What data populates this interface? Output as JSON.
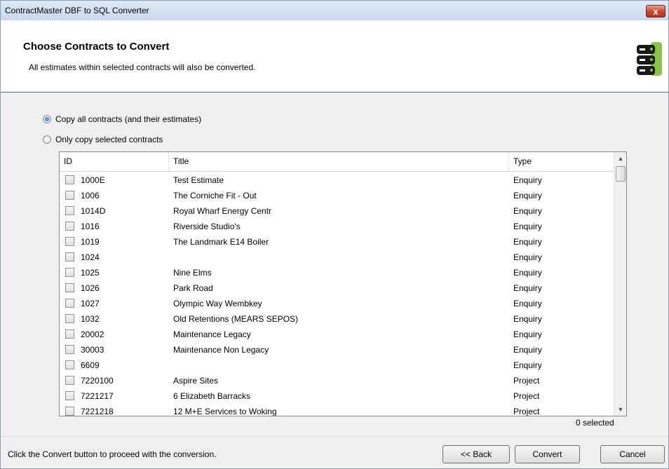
{
  "window": {
    "title": "ContractMaster DBF to SQL Converter",
    "close_label": "x"
  },
  "header": {
    "title": "Choose Contracts to Convert",
    "subtitle": "All estimates within selected contracts will also be converted.",
    "icon": "database-server-icon"
  },
  "options": {
    "all": {
      "label": "Copy all contracts (and their estimates)",
      "selected": true
    },
    "selected": {
      "label": "Only copy selected contracts",
      "selected": false
    }
  },
  "table": {
    "columns": [
      "ID",
      "Title",
      "Type"
    ],
    "rows": [
      {
        "id": "1000E",
        "title": "Test Estimate",
        "type": "Enquiry"
      },
      {
        "id": "1006",
        "title": "The Corniche Fit - Out",
        "type": "Enquiry"
      },
      {
        "id": "1014D",
        "title": "Royal Wharf Energy Centr",
        "type": "Enquiry"
      },
      {
        "id": "1016",
        "title": "Riverside Studio's",
        "type": "Enquiry"
      },
      {
        "id": "1019",
        "title": "The Landmark E14 Boiler",
        "type": "Enquiry"
      },
      {
        "id": "1024",
        "title": "",
        "type": "Enquiry"
      },
      {
        "id": "1025",
        "title": "Nine Elms",
        "type": "Enquiry"
      },
      {
        "id": "1026",
        "title": "Park Road",
        "type": "Enquiry"
      },
      {
        "id": "1027",
        "title": "Olympic Way Wembkey",
        "type": "Enquiry"
      },
      {
        "id": "1032",
        "title": "Old Retentions (MEARS SEPOS)",
        "type": "Enquiry"
      },
      {
        "id": "20002",
        "title": "Maintenance Legacy",
        "type": "Enquiry"
      },
      {
        "id": "30003",
        "title": "Maintenance Non Legacy",
        "type": "Enquiry"
      },
      {
        "id": "6609",
        "title": "",
        "type": "Enquiry"
      },
      {
        "id": "7220100",
        "title": "Aspire Sites",
        "type": "Project"
      },
      {
        "id": "7221217",
        "title": "6 Elizabeth Barracks",
        "type": "Project"
      },
      {
        "id": "7221218",
        "title": "12 M+E Services to Woking",
        "type": "Project"
      }
    ],
    "selected_count": "0 selected"
  },
  "footer": {
    "hint": "Click the Convert button to proceed with the conversion.",
    "back_label": "<< Back",
    "convert_label": "Convert",
    "cancel_label": "Cancel"
  },
  "colors": {
    "accent": "#4f6f9a",
    "icon_green": "#8bc34a",
    "icon_dark": "#1a1a1a"
  }
}
